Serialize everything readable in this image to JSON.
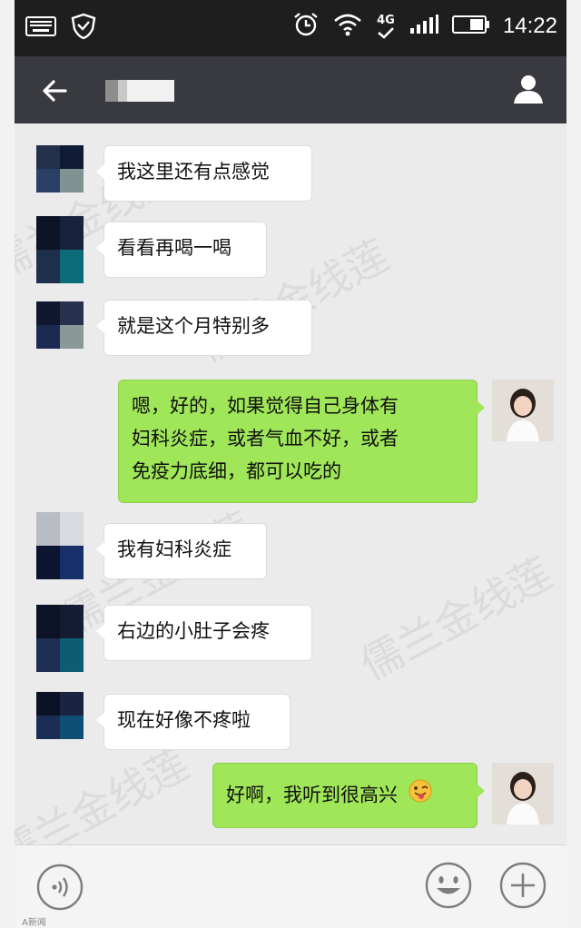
{
  "status_bar": {
    "time": "14:22",
    "network": "4G",
    "icons": [
      "keyboard-icon",
      "shield-icon",
      "alarm-icon",
      "wifi-icon",
      "signal-icon",
      "battery-icon"
    ]
  },
  "header": {
    "contact_name": "",
    "icons": [
      "back-arrow-icon",
      "profile-icon"
    ]
  },
  "messages": [
    {
      "side": "in",
      "lines": [
        "我这里还有点感觉"
      ]
    },
    {
      "side": "in",
      "lines": [
        "看看再喝一喝"
      ]
    },
    {
      "side": "in",
      "lines": [
        "就是这个月特别多"
      ]
    },
    {
      "side": "out",
      "lines": [
        "嗯，好的，如果觉得自己身体有",
        "妇科炎症，或者气血不好，或者",
        "免疫力底细，都可以吃的"
      ]
    },
    {
      "side": "in",
      "lines": [
        "我有妇科炎症"
      ]
    },
    {
      "side": "in",
      "lines": [
        "右边的小肚子会疼"
      ]
    },
    {
      "side": "in",
      "lines": [
        "现在好像不疼啦"
      ]
    },
    {
      "side": "out",
      "lines": [
        "好啊，我听到很高兴"
      ],
      "emoji": "tongue-wink-emoji"
    }
  ],
  "watermark": "儒兰金线莲",
  "footer": {
    "source": "A新闻",
    "icons": [
      "voice-icon",
      "emoji-icon",
      "plus-icon"
    ]
  },
  "colors": {
    "status_bar": "#1e1e1e",
    "header": "#393a3f",
    "chat_bg": "#ebebeb",
    "bubble_in": "#ffffff",
    "bubble_out": "#9fe658"
  }
}
